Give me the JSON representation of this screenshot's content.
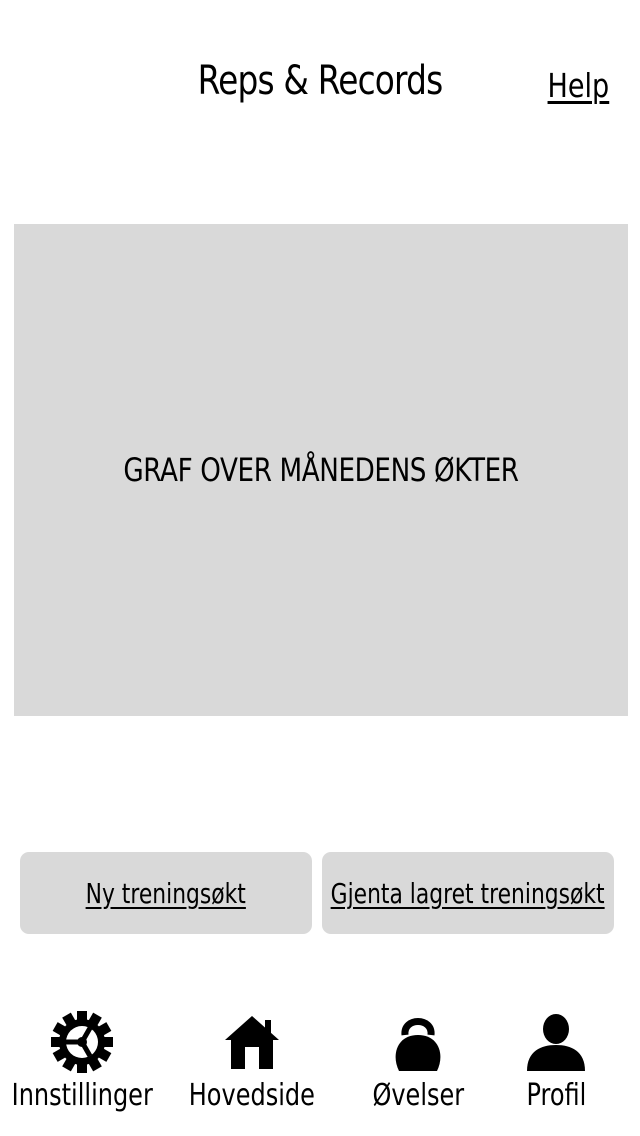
{
  "header": {
    "title": "Reps & Records",
    "help_label": "Help"
  },
  "main": {
    "graph_placeholder_text": "GRAF OVER MÅNEDENS ØKTER"
  },
  "actions": {
    "new_workout_label": "Ny treningsøkt",
    "repeat_workout_label": "Gjenta lagret treningsøkt"
  },
  "bottom_nav": {
    "items": [
      {
        "label": "Innstillinger",
        "icon": "gear-icon"
      },
      {
        "label": "Hovedside",
        "icon": "home-icon"
      },
      {
        "label": "Øvelser",
        "icon": "kettlebell-icon"
      },
      {
        "label": "Profil",
        "icon": "person-icon"
      }
    ]
  },
  "colors": {
    "background": "#ffffff",
    "panel": "#d9d9d9",
    "text": "#000000"
  }
}
